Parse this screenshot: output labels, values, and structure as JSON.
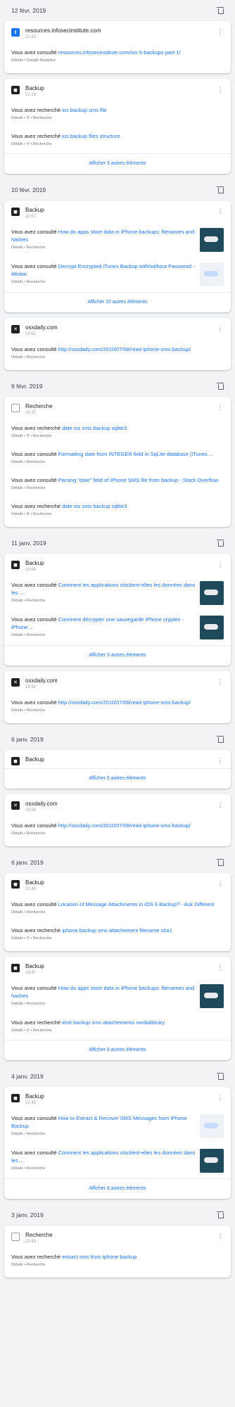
{
  "days": [
    {
      "date": "12 févr. 2019",
      "cards": [
        {
          "site": "resources.infosecinstitute.com",
          "time": "21:20",
          "icon": "I",
          "icon_class": "fav-I",
          "entries": [
            {
              "prefix": "Vous avez consulté ",
              "link": "resources.infosecinstitute.com/ios-5-backups-part-1/",
              "meta": "Détails • Google Analytics",
              "thumb": ""
            }
          ],
          "more": ""
        },
        {
          "site": "Backup",
          "time": "21:18",
          "icon": "◼",
          "icon_class": "fav-backup",
          "entries": [
            {
              "prefix": "Vous avez recherché ",
              "link": "ios backup sms file",
              "meta": "Détails • ⚲ • Recherche",
              "thumb": ""
            },
            {
              "prefix": "Vous avez recherché ",
              "link": "ios backup files structure",
              "meta": "Détails • ⚲ • Recherche",
              "thumb": ""
            }
          ],
          "more": "Afficher 3 autres éléments"
        }
      ]
    },
    {
      "date": "10 févr. 2019",
      "cards": [
        {
          "site": "Backup",
          "time": "22:57",
          "icon": "◼",
          "icon_class": "fav-backup",
          "entries": [
            {
              "prefix": "Vous avez consulté ",
              "link": "How do apps store data in iPhone backups: filenames and hashes",
              "meta": "Détails • Recherche",
              "thumb": "dark"
            },
            {
              "prefix": "Vous avez consulté ",
              "link": "Decrypt Encrypted iTunes Backup with/without Password - iMobie",
              "meta": "Détails • Recherche",
              "thumb": "light"
            }
          ],
          "more": "Afficher 10 autres éléments"
        },
        {
          "site": "osxdaily.com",
          "time": "19:52",
          "icon": "✕",
          "icon_class": "fav-osx",
          "entries": [
            {
              "prefix": "Vous avez consulté ",
              "link": "http://osxdaily.com/2010/07/08/read-iphone-sms-backup/",
              "meta": "Détails • Recherche",
              "thumb": ""
            }
          ],
          "more": ""
        }
      ]
    },
    {
      "date": "9 févr. 2019",
      "cards": [
        {
          "site": "Recherche",
          "time": "16:37",
          "icon": "▤",
          "icon_class": "fav-search",
          "entries": [
            {
              "prefix": "Vous avez recherché ",
              "link": "date ios sms backup sqlite3",
              "meta": "Détails • ⚲ • Recherche",
              "thumb": ""
            },
            {
              "prefix": "Vous avez consulté ",
              "link": "Formatting date from INTEGER field in SqLite database (iTunes ...",
              "meta": "Détails • Recherche",
              "thumb": ""
            },
            {
              "prefix": "Vous avez consulté ",
              "link": "Parsing \"date\" field of iPhone SMS file from backup - Stack Overflow",
              "meta": "Détails • Recherche",
              "thumb": ""
            },
            {
              "prefix": "Vous avez recherché ",
              "link": "date ios sms backup sqlite3",
              "meta": "Détails • ⚲ • Recherche",
              "thumb": ""
            }
          ],
          "more": ""
        }
      ]
    },
    {
      "date": "11 janv. 2019",
      "cards": [
        {
          "site": "Backup",
          "time": "19:54",
          "icon": "◼",
          "icon_class": "fav-backup",
          "entries": [
            {
              "prefix": "Vous avez consulté ",
              "link": "Comment les applications stockent-elles les données dans les ...",
              "meta": "Détails • Recherche",
              "thumb": "dark"
            },
            {
              "prefix": "Vous avez consulté ",
              "link": "Comment décrypter une sauvegarde iPhone cryptée - iPhone ...",
              "meta": "Détails • Recherche",
              "thumb": "dark"
            }
          ],
          "more": "Afficher 5 autres éléments"
        },
        {
          "site": "osxdaily.com",
          "time": "19:52",
          "icon": "✕",
          "icon_class": "fav-osx",
          "entries": [
            {
              "prefix": "Vous avez consulté ",
              "link": "http://osxdaily.com/2010/07/08/read-iphone-sms-backup/",
              "meta": "Détails • Recherche",
              "thumb": ""
            }
          ],
          "more": ""
        }
      ]
    },
    {
      "date": "6 janv. 2019",
      "cards": [
        {
          "site": "Backup",
          "time": "",
          "icon": "◼",
          "icon_class": "fav-backup",
          "entries": [],
          "more": "Afficher 5 autres éléments"
        },
        {
          "site": "osxdaily.com",
          "time": "19:50",
          "icon": "✕",
          "icon_class": "fav-osx",
          "entries": [
            {
              "prefix": "Vous avez consulté ",
              "link": "http://osxdaily.com/2010/07/08/read-iphone-sms-backup/",
              "meta": "Détails • Recherche",
              "thumb": ""
            }
          ],
          "more": ""
        }
      ]
    },
    {
      "date": "6 janv. 2019",
      "cards": [
        {
          "site": "Backup",
          "time": "22:46",
          "icon": "◼",
          "icon_class": "fav-backup",
          "entries": [
            {
              "prefix": "Vous avez consulté ",
              "link": "Location of Message Attachments in iOS 6 Backup? - Ask Different",
              "meta": "Détails • Recherche",
              "thumb": ""
            },
            {
              "prefix": "Vous avez recherché ",
              "link": "iphone backup sms attachement filename sha1",
              "meta": "Détails • ⚲ • Recherche",
              "thumb": ""
            }
          ],
          "more": ""
        },
        {
          "site": "Backup",
          "time": "18:47",
          "icon": "◼",
          "icon_class": "fav-backup",
          "entries": [
            {
              "prefix": "Vous avez consulté ",
              "link": "How do apps store data in iPhone backups: filenames and hashes",
              "meta": "Détails • Recherche",
              "thumb": "dark"
            },
            {
              "prefix": "Vous avez recherché ",
              "link": "ios6 backup sms attachements medialibrary",
              "meta": "Détails • ⚲ • Recherche",
              "thumb": ""
            }
          ],
          "more": "Afficher 8 autres éléments"
        }
      ]
    },
    {
      "date": "4 janv. 2019",
      "cards": [
        {
          "site": "Backup",
          "time": "22:45",
          "icon": "◼",
          "icon_class": "fav-backup",
          "entries": [
            {
              "prefix": "Vous avez consulté ",
              "link": "How to Extract & Recover SMS Messages from iPhone Backup",
              "meta": "Détails • Recherche",
              "thumb": "light"
            },
            {
              "prefix": "Vous avez consulté ",
              "link": "Comment les applications stockent-elles les données dans les ...",
              "meta": "Détails • Recherche",
              "thumb": "dark"
            }
          ],
          "more": "Afficher 8 autres éléments"
        }
      ]
    },
    {
      "date": "3 janv. 2019",
      "cards": [
        {
          "site": "Recherche",
          "time": "22:43",
          "icon": "▤",
          "icon_class": "fav-search",
          "entries": [
            {
              "prefix": "Vous avez recherché ",
              "link": "extract sms from iphone backup",
              "meta": "Détails • Recherche",
              "thumb": ""
            }
          ],
          "more": ""
        }
      ]
    }
  ]
}
